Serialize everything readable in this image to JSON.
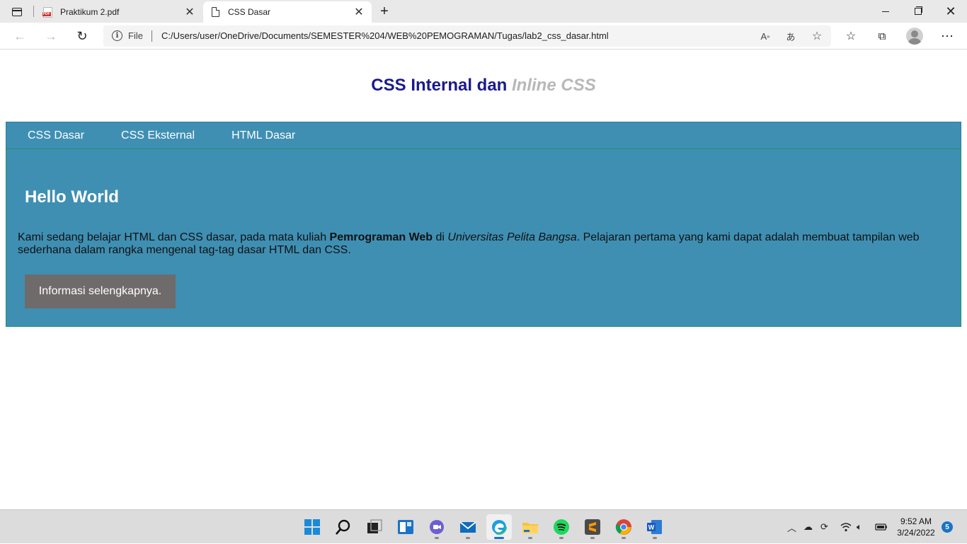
{
  "browser": {
    "tabs": [
      {
        "title": "Praktikum 2.pdf",
        "icon": "pdf-icon",
        "active": false
      },
      {
        "title": "CSS Dasar",
        "icon": "page-icon",
        "active": true
      }
    ],
    "address": {
      "scheme": "File",
      "url": "C:/Users/user/OneDrive/Documents/SEMESTER%204/WEB%20PEMOGRAMAN/Tugas/lab2_css_dasar.html"
    }
  },
  "page": {
    "title_main": "CSS Internal dan",
    "title_inline": "Inline CSS",
    "nav": [
      {
        "label": "CSS Dasar"
      },
      {
        "label": "CSS Eksternal"
      },
      {
        "label": "HTML Dasar"
      }
    ],
    "heading": "Hello World",
    "paragraph": {
      "part1": "Kami sedang belajar HTML dan CSS dasar, pada mata kuliah ",
      "bold": "Pemrograman Web",
      "part2": " di ",
      "italic": "Universitas Pelita Bangsa",
      "part3": ". Pelajaran pertama yang kami dapat adalah membuat tampilan web sederhana dalam rangka mengenal tag-tag dasar HTML dan CSS."
    },
    "button_label": "Informasi selengkapnya."
  },
  "taskbar": {
    "time": "9:52 AM",
    "date": "3/24/2022",
    "notification_count": "5"
  },
  "colors": {
    "nav_bg": "#3f8fb3",
    "title_blue": "#1a1a8c",
    "title_inline_gray": "#b8b8b8",
    "button_bg": "#6f6b6b"
  }
}
